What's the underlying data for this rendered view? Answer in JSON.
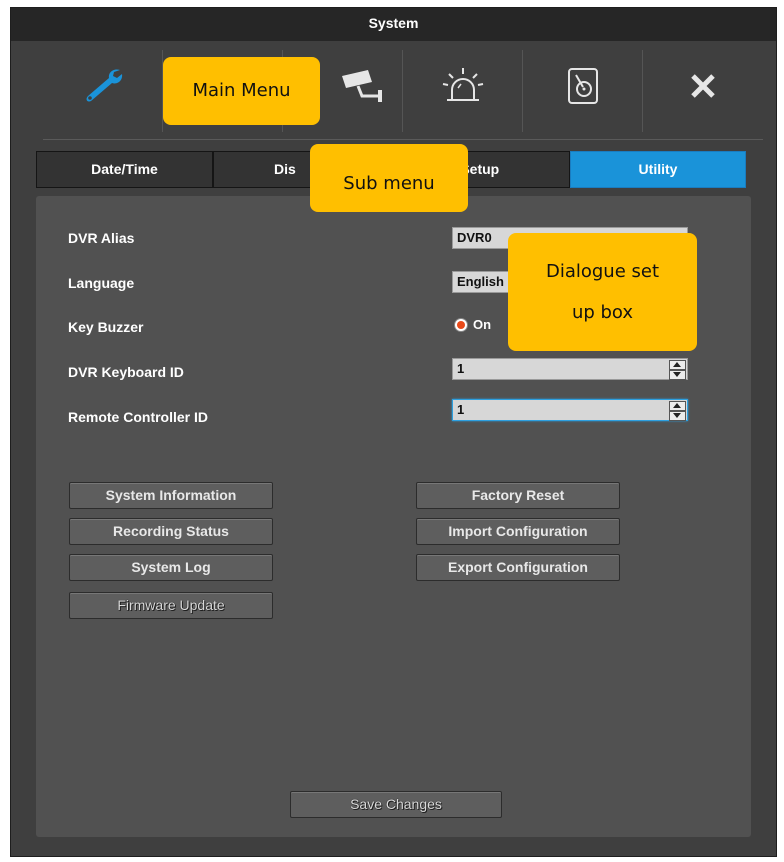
{
  "window": {
    "title": "System"
  },
  "main_menu": {
    "items": [
      {
        "name": "wrench-icon",
        "color": "#1a93d9"
      },
      {
        "name": "monitor-icon"
      },
      {
        "name": "camera-icon"
      },
      {
        "name": "alarm-icon"
      },
      {
        "name": "hard-disk-icon"
      },
      {
        "name": "close-icon"
      }
    ]
  },
  "sub_tabs": [
    {
      "label": "Date/Time"
    },
    {
      "label": "Dis"
    },
    {
      "label": "r Setup"
    },
    {
      "label": "Utility",
      "active": true,
      "color": "#1a93d9"
    }
  ],
  "settings": {
    "dvr_alias": {
      "label": "DVR Alias",
      "value": "DVR0"
    },
    "language": {
      "label": "Language",
      "value": "English"
    },
    "key_buzzer": {
      "label": "Key Buzzer",
      "option": "On"
    },
    "keyboard_id": {
      "label": "DVR Keyboard ID",
      "value": "1"
    },
    "remote_id": {
      "label": "Remote Controller ID",
      "value": "1"
    }
  },
  "buttons": {
    "system_information": "System Information",
    "recording_status": "Recording Status",
    "system_log": "System Log",
    "firmware_update": "Firmware Update",
    "factory_reset": "Factory Reset",
    "import_configuration": "Import Configuration",
    "export_configuration": "Export Configuration",
    "save_changes": "Save Changes"
  },
  "callouts": {
    "main_menu": "Main Menu",
    "sub_menu": "Sub menu",
    "dialogue_line1": "Dialogue set",
    "dialogue_line2": "up box",
    "color": "#ffbf00"
  }
}
